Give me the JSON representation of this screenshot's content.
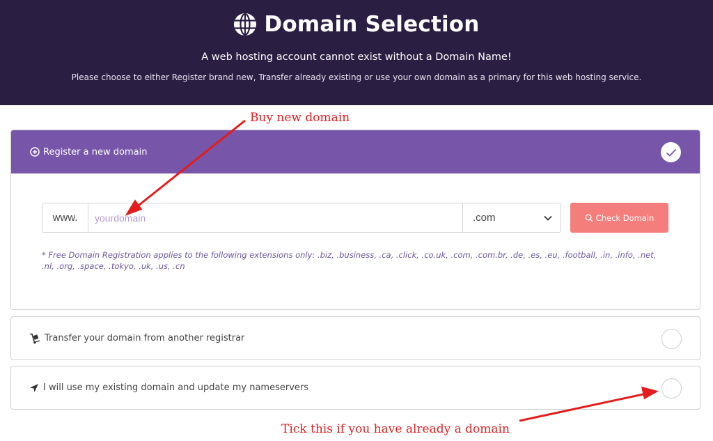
{
  "header": {
    "title": "Domain Selection",
    "subtitle": "A web hosting account cannot exist without a Domain Name!",
    "description": "Please choose to either Register brand new, Transfer already existing or use your own domain as a primary for this web hosting service."
  },
  "register": {
    "label": "Register a new domain",
    "selected": true,
    "www_prefix": "www.",
    "input_placeholder": "yourdomain",
    "input_value": "",
    "extension": ".com",
    "check_label": "Check Domain",
    "note": "* Free Domain Registration applies to the following extensions only: .biz, .business, .ca, .click, .co.uk, .com, .com.br, .de, .es, .eu, .football, .in, .info, .net, .nl, .org, .space, .tokyo, .uk, .us, .cn"
  },
  "transfer": {
    "label": "Transfer your domain from another registrar",
    "selected": false
  },
  "existing": {
    "label": "I will use my existing domain and update my nameservers",
    "selected": false
  },
  "annotations": {
    "buy": "Buy new domain",
    "tick": "Tick this if you have already a domain"
  },
  "colors": {
    "header_bg": "#2b1e43",
    "accent_purple": "#7755a8",
    "check_button": "#f47e7c",
    "annotation_red": "#e31d1d",
    "note_text": "#6b56a0"
  },
  "icons": {
    "title": "globe-icon",
    "register": "plus-circle-icon",
    "selected": "checkmark-icon",
    "extension_dropdown": "chevron-down-icon",
    "check_button": "search-icon",
    "transfer": "hand-truck-icon",
    "existing": "location-arrow-icon"
  }
}
